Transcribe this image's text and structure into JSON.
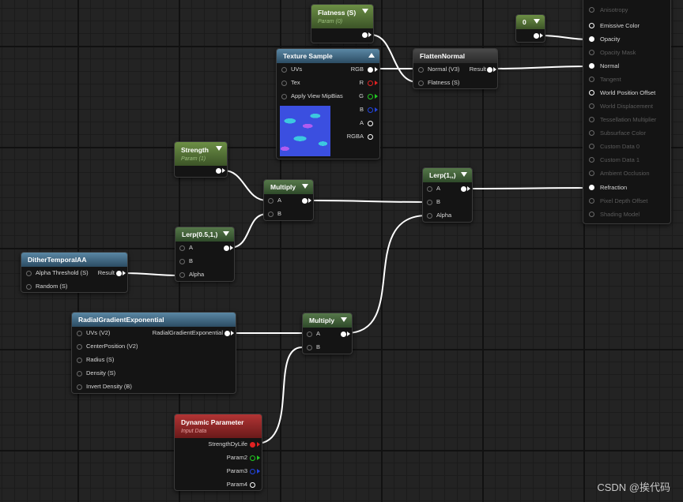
{
  "nodes": {
    "flatness": {
      "title": "Flatness (S)",
      "subtitle": "Param (0)"
    },
    "const0": {
      "title": "0"
    },
    "texture": {
      "title": "Texture Sample",
      "inputs": [
        "UVs",
        "Tex",
        "Apply View MipBias"
      ],
      "outputs": [
        "RGB",
        "R",
        "G",
        "B",
        "A",
        "RGBA"
      ]
    },
    "flatten": {
      "title": "FlattenNormal",
      "inputs": [
        "Normal (V3)",
        "Flatness (S)"
      ],
      "output": "Result"
    },
    "strength": {
      "title": "Strength",
      "subtitle": "Param (1)"
    },
    "multiply1": {
      "title": "Multiply",
      "inputs": [
        "A",
        "B"
      ]
    },
    "lerp1": {
      "title": "Lerp(1,,)",
      "inputs": [
        "A",
        "B",
        "Alpha"
      ]
    },
    "lerp05": {
      "title": "Lerp(0.5,1,)",
      "inputs": [
        "A",
        "B",
        "Alpha"
      ]
    },
    "dither": {
      "title": "DitherTemporalAA",
      "inputs": [
        "Alpha Threshold (S)",
        "Random (S)"
      ],
      "output": "Result"
    },
    "radial": {
      "title": "RadialGradientExponential",
      "inputs": [
        "UVs (V2)",
        "CenterPosition (V2)",
        "Radius (S)",
        "Density (S)",
        "Invert Density (B)"
      ],
      "output": "RadialGradientExponential"
    },
    "multiply2": {
      "title": "Multiply",
      "inputs": [
        "A",
        "B"
      ]
    },
    "dynparam": {
      "title": "Dynamic Parameter",
      "subtitle": "Input Data",
      "outputs": [
        "StrengthDyLife",
        "Param2",
        "Param3",
        "Param4"
      ]
    }
  },
  "material": {
    "pins": [
      {
        "label": "Anisotropy",
        "active": false
      },
      {
        "label": "Emissive Color",
        "active": true
      },
      {
        "label": "Opacity",
        "active": true
      },
      {
        "label": "Opacity Mask",
        "active": false
      },
      {
        "label": "Normal",
        "active": true
      },
      {
        "label": "Tangent",
        "active": false
      },
      {
        "label": "World Position Offset",
        "active": true
      },
      {
        "label": "World Displacement",
        "active": false
      },
      {
        "label": "Tessellation Multiplier",
        "active": false
      },
      {
        "label": "Subsurface Color",
        "active": false
      },
      {
        "label": "Custom Data 0",
        "active": false
      },
      {
        "label": "Custom Data 1",
        "active": false
      },
      {
        "label": "Ambient Occlusion",
        "active": false
      },
      {
        "label": "Refraction",
        "active": true
      },
      {
        "label": "Pixel Depth Offset",
        "active": false
      },
      {
        "label": "Shading Model",
        "active": false
      }
    ]
  },
  "watermark": "CSDN @挨代码",
  "colors": {
    "wire": "#ffffff",
    "param_header": "#6c8f45",
    "function_header": "#5a87a4",
    "dynamic_header": "#b23434"
  }
}
